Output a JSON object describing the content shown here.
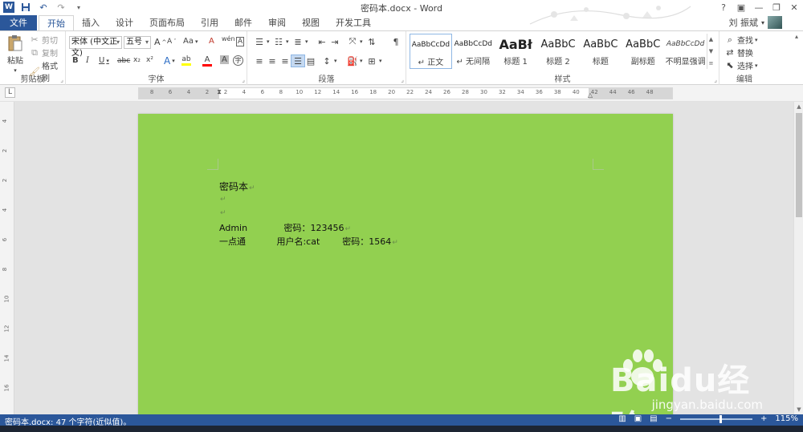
{
  "titlebar": {
    "title": "密码本.docx - Word",
    "qat": {
      "save_icon": "save-icon",
      "undo_icon": "undo-icon",
      "redo_icon": "redo-icon",
      "customize_icon": "customize-qat-icon"
    },
    "controls": {
      "help": "?",
      "ribbon_display": "▣",
      "minimize": "—",
      "restore": "❐",
      "close": "✕"
    }
  },
  "tabs": [
    {
      "label": "文件",
      "active": false
    },
    {
      "label": "开始",
      "active": true
    },
    {
      "label": "插入",
      "active": false
    },
    {
      "label": "设计",
      "active": false
    },
    {
      "label": "页面布局",
      "active": false
    },
    {
      "label": "引用",
      "active": false
    },
    {
      "label": "邮件",
      "active": false
    },
    {
      "label": "审阅",
      "active": false
    },
    {
      "label": "视图",
      "active": false
    },
    {
      "label": "开发工具",
      "active": false
    }
  ],
  "user": {
    "name": "刘 振斌",
    "dropdown": "▾"
  },
  "ribbon": {
    "clipboard": {
      "label": "剪贴板",
      "paste": "粘贴",
      "cut": "剪切",
      "copy": "复制",
      "format_painter": "格式刷"
    },
    "font": {
      "label": "字体",
      "font_name": "宋体 (中文正文)",
      "font_size": "五号",
      "grow": "A",
      "shrink": "A",
      "change_case": "Aa",
      "clear_format": "A",
      "phonetic": "wén",
      "char_border": "A",
      "bold": "B",
      "italic": "I",
      "underline": "U",
      "strike": "abc",
      "subscript": "x₂",
      "superscript": "x²",
      "text_effect": "A",
      "highlight": "ab",
      "font_color": "A",
      "char_shading": "A",
      "enclose": "字",
      "highlight_color": "#ffff00",
      "font_color_value": "#ff0000"
    },
    "paragraph": {
      "label": "段落"
    },
    "styles": {
      "label": "样式",
      "items": [
        {
          "preview": "AaBbCcDd",
          "name": "↵ 正文",
          "selected": true
        },
        {
          "preview": "AaBbCcDd",
          "name": "↵ 无间隔",
          "selected": false
        },
        {
          "preview": "AaBł",
          "name": "标题 1",
          "selected": false
        },
        {
          "preview": "AaBbC",
          "name": "标题 2",
          "selected": false
        },
        {
          "preview": "AaBbC",
          "name": "标题",
          "selected": false
        },
        {
          "preview": "AaBbC",
          "name": "副标题",
          "selected": false
        },
        {
          "preview": "AaBbCcDd",
          "name": "不明显强调",
          "selected": false
        }
      ]
    },
    "editing": {
      "label": "编辑",
      "find": "查找",
      "replace": "替换",
      "select": "选择"
    }
  },
  "ruler": {
    "tab_selector": "L",
    "ticks": [
      "8",
      "6",
      "4",
      "2",
      "2",
      "4",
      "6",
      "8",
      "10",
      "12",
      "14",
      "16",
      "18",
      "20",
      "22",
      "24",
      "26",
      "28",
      "30",
      "32",
      "34",
      "36",
      "38",
      "40",
      "42",
      "44",
      "46",
      "48"
    ],
    "vticks": [
      "4",
      "2",
      "2",
      "4",
      "6",
      "8",
      "10",
      "12",
      "14",
      "16"
    ]
  },
  "document": {
    "page_color": "#92d050",
    "lines": [
      {
        "text": "密码本",
        "mark": "↵"
      },
      {
        "text": "",
        "mark": "↵"
      },
      {
        "text": "",
        "mark": "↵"
      },
      {
        "text": "Admin             密码：123456",
        "mark": "↵"
      },
      {
        "text": "一点通           用户名:cat        密码：1564",
        "mark": "↵"
      }
    ]
  },
  "statusbar": {
    "text": "密码本.docx: 47 个字符(近似值)。",
    "zoom_minus": "−",
    "zoom_plus": "+",
    "zoom_level": "115%",
    "zoom_fraction": 0.56
  },
  "watermark": {
    "brand": "Baidu经验",
    "url": "jingyan.baidu.com"
  }
}
